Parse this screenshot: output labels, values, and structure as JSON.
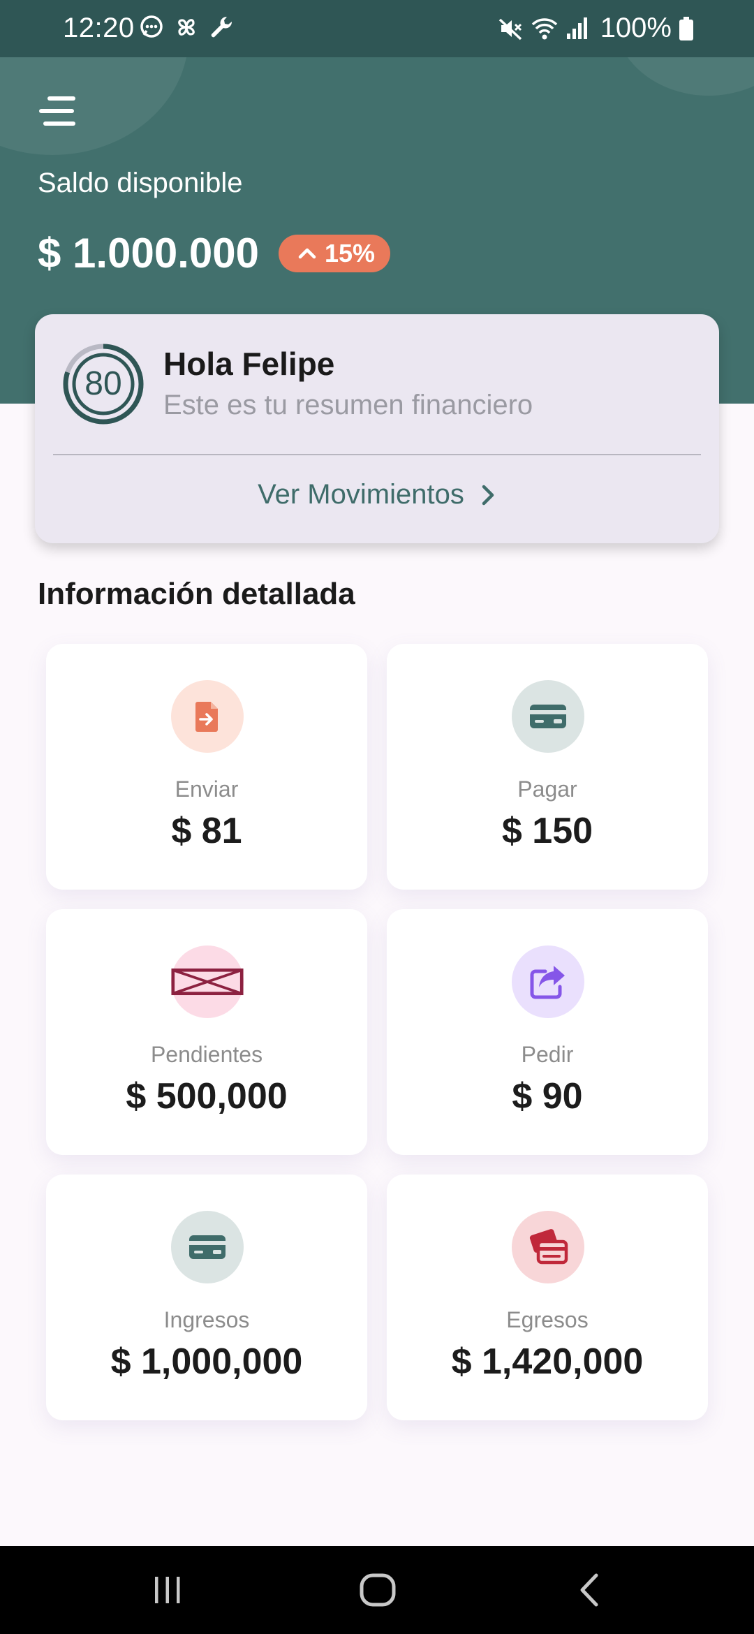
{
  "status_bar": {
    "time": "12:20",
    "battery_text": "100%"
  },
  "header": {
    "balance_label": "Saldo disponible",
    "balance_amount": "$ 1.000.000",
    "change_badge": "15%"
  },
  "summary": {
    "score": "80",
    "score_progress": 0.8,
    "greeting": "Hola Felipe",
    "subtitle": "Este es tu resumen financiero",
    "link_label": "Ver Movimientos"
  },
  "section": {
    "title": "Información detallada"
  },
  "tiles": [
    {
      "label": "Enviar",
      "value": "$ 81",
      "icon": "send-document-icon",
      "color": "#e9795a",
      "bg": "#fde3da"
    },
    {
      "label": "Pagar",
      "value": "$ 150",
      "icon": "credit-card-icon",
      "color": "#3f6c6a",
      "bg": "#dbe4e3"
    },
    {
      "label": "Pendientes",
      "value": "$ 500,000",
      "icon": "broken-image-icon",
      "color": "#8c2140",
      "bg": "#fcdbe6"
    },
    {
      "label": "Pedir",
      "value": "$ 90",
      "icon": "share-icon",
      "color": "#8556e8",
      "bg": "#eae0fd"
    },
    {
      "label": "Ingresos",
      "value": "$ 1,000,000",
      "icon": "credit-card-icon",
      "color": "#3f6c6a",
      "bg": "#dbe4e3"
    },
    {
      "label": "Egresos",
      "value": "$ 1,420,000",
      "icon": "cards-icon",
      "color": "#c0283a",
      "bg": "#f8d6d8"
    }
  ],
  "colors": {
    "status_bar": "#2f5655",
    "header": "#42706d",
    "accent": "#e9795a",
    "card": "#ebe7f1"
  }
}
